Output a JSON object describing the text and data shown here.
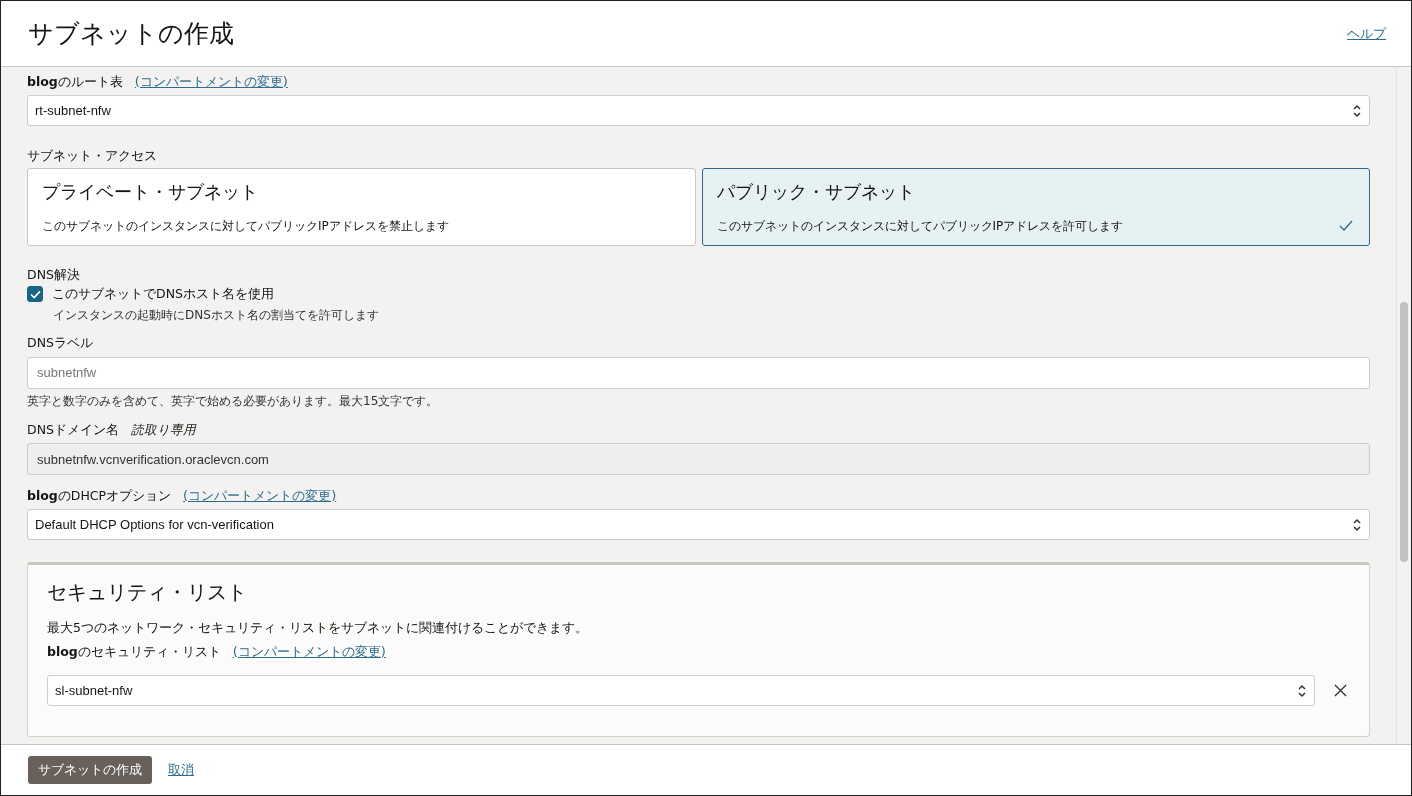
{
  "header": {
    "title": "サブネットの作成",
    "help_link": "ヘルプ"
  },
  "route_table": {
    "label": "**blog**のルート表",
    "link": "(コンパートメントの変更)",
    "value": "rt-subnet-nfw"
  },
  "subnet_access": {
    "label": "サブネット・アクセス",
    "options": [
      {
        "title": "プライベート・サブネット",
        "description": "このサブネットのインスタンスに対してパブリックIPアドレスを禁止します",
        "selected": false
      },
      {
        "title": "パブリック・サブネット",
        "description": "このサブネットのインスタンスに対してパブリックIPアドレスを許可します",
        "selected": true
      }
    ]
  },
  "dns_resolution": {
    "label": "DNS解決",
    "checkbox_label": "このサブネットでDNSホスト名を使用",
    "checked": true,
    "help": "インスタンスの起動時にDNSホスト名の割当てを許可します"
  },
  "dns_label": {
    "label": "DNSラベル",
    "placeholder": "subnetnfw",
    "help": "英字と数字のみを含めて、英字で始める必要があります。最大15文字です。"
  },
  "dns_domain": {
    "label": "DNSドメイン名",
    "read_only": "読取り専用",
    "value": "subnetnfw.vcnverification.oraclevcn.com"
  },
  "dhcp_options": {
    "label": "**blog**のDHCPオプション",
    "link": "(コンパートメントの変更)",
    "value": "Default DHCP Options for vcn-verification"
  },
  "security_list": {
    "title": "セキュリティ・リスト",
    "description": "最大5つのネットワーク・セキュリティ・リストをサブネットに関連付けることができます。",
    "label": "**blog**のセキュリティ・リスト",
    "link": "(コンパートメントの変更)",
    "value": "sl-subnet-nfw"
  },
  "footer": {
    "create_button": "サブネットの作成",
    "cancel_link": "取消"
  }
}
